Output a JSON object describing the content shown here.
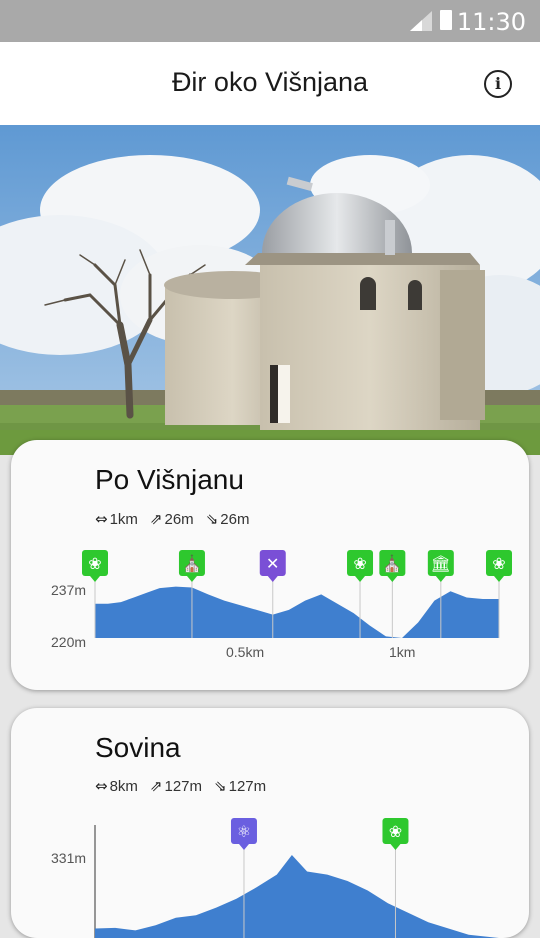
{
  "status_bar": {
    "time": "11:30"
  },
  "app_bar": {
    "title": "Đir oko Višnjana",
    "info_icon": "i"
  },
  "hero_photo": {
    "subject": "observatory-photo"
  },
  "routes": [
    {
      "title": "Po Višnjanu",
      "distance": "1km",
      "ascent": "26m",
      "descent": "26m",
      "elevation_labels": [
        "237m",
        "220m"
      ],
      "distance_labels": [
        "0.5km",
        "1km"
      ],
      "poi_icons": [
        "nature-icon",
        "church-icon",
        "restaurant-icon",
        "nature-icon",
        "church-icon",
        "museum-icon",
        "nature-icon"
      ],
      "chart_data": {
        "type": "area",
        "x": [
          0,
          0.04,
          0.08,
          0.12,
          0.16,
          0.2,
          0.25,
          0.3,
          0.35,
          0.4,
          0.45,
          0.5,
          0.55,
          0.6,
          0.65,
          0.7,
          0.75,
          0.8,
          0.85,
          0.9,
          0.95,
          1.0,
          1.05,
          1.1,
          1.15,
          1.2,
          1.25
        ],
        "y": [
          231,
          231,
          231.5,
          233,
          234.5,
          236,
          236.5,
          236.2,
          234,
          232,
          230.5,
          229,
          227.5,
          229,
          232,
          234,
          231,
          228,
          224,
          220.5,
          220,
          225,
          232,
          235,
          233,
          232.5,
          232.5
        ],
        "x_ticks": [
          0.5,
          1
        ],
        "ylim": [
          220,
          237
        ],
        "xlim": [
          0,
          1.25
        ]
      }
    },
    {
      "title": "Sovina",
      "distance": "8km",
      "ascent": "127m",
      "descent": "127m",
      "elevation_labels": [
        "331m"
      ],
      "poi_icons": [
        "science-icon",
        "nature-icon"
      ],
      "chart_data": {
        "type": "area",
        "x": [
          0,
          0.4,
          0.8,
          1.2,
          1.6,
          2.0,
          2.4,
          2.8,
          3.2,
          3.6,
          3.9,
          4.2,
          4.6,
          5.0,
          5.4,
          5.8,
          6.2,
          6.6,
          7.0,
          7.4,
          8.0
        ],
        "y": [
          215,
          216,
          212,
          220,
          232,
          236,
          248,
          262,
          280,
          300,
          331,
          305,
          300,
          290,
          275,
          255,
          240,
          225,
          215,
          205,
          200
        ],
        "ylim": [
          200,
          331
        ],
        "xlim": [
          0,
          8
        ]
      }
    }
  ],
  "colors": {
    "nature": "#2ec82e",
    "church": "#2ec82e",
    "restaurant": "#7a4fd6",
    "museum": "#2ec82e",
    "science": "#6a5fe0",
    "profile_fill": "#3f7fcf"
  }
}
